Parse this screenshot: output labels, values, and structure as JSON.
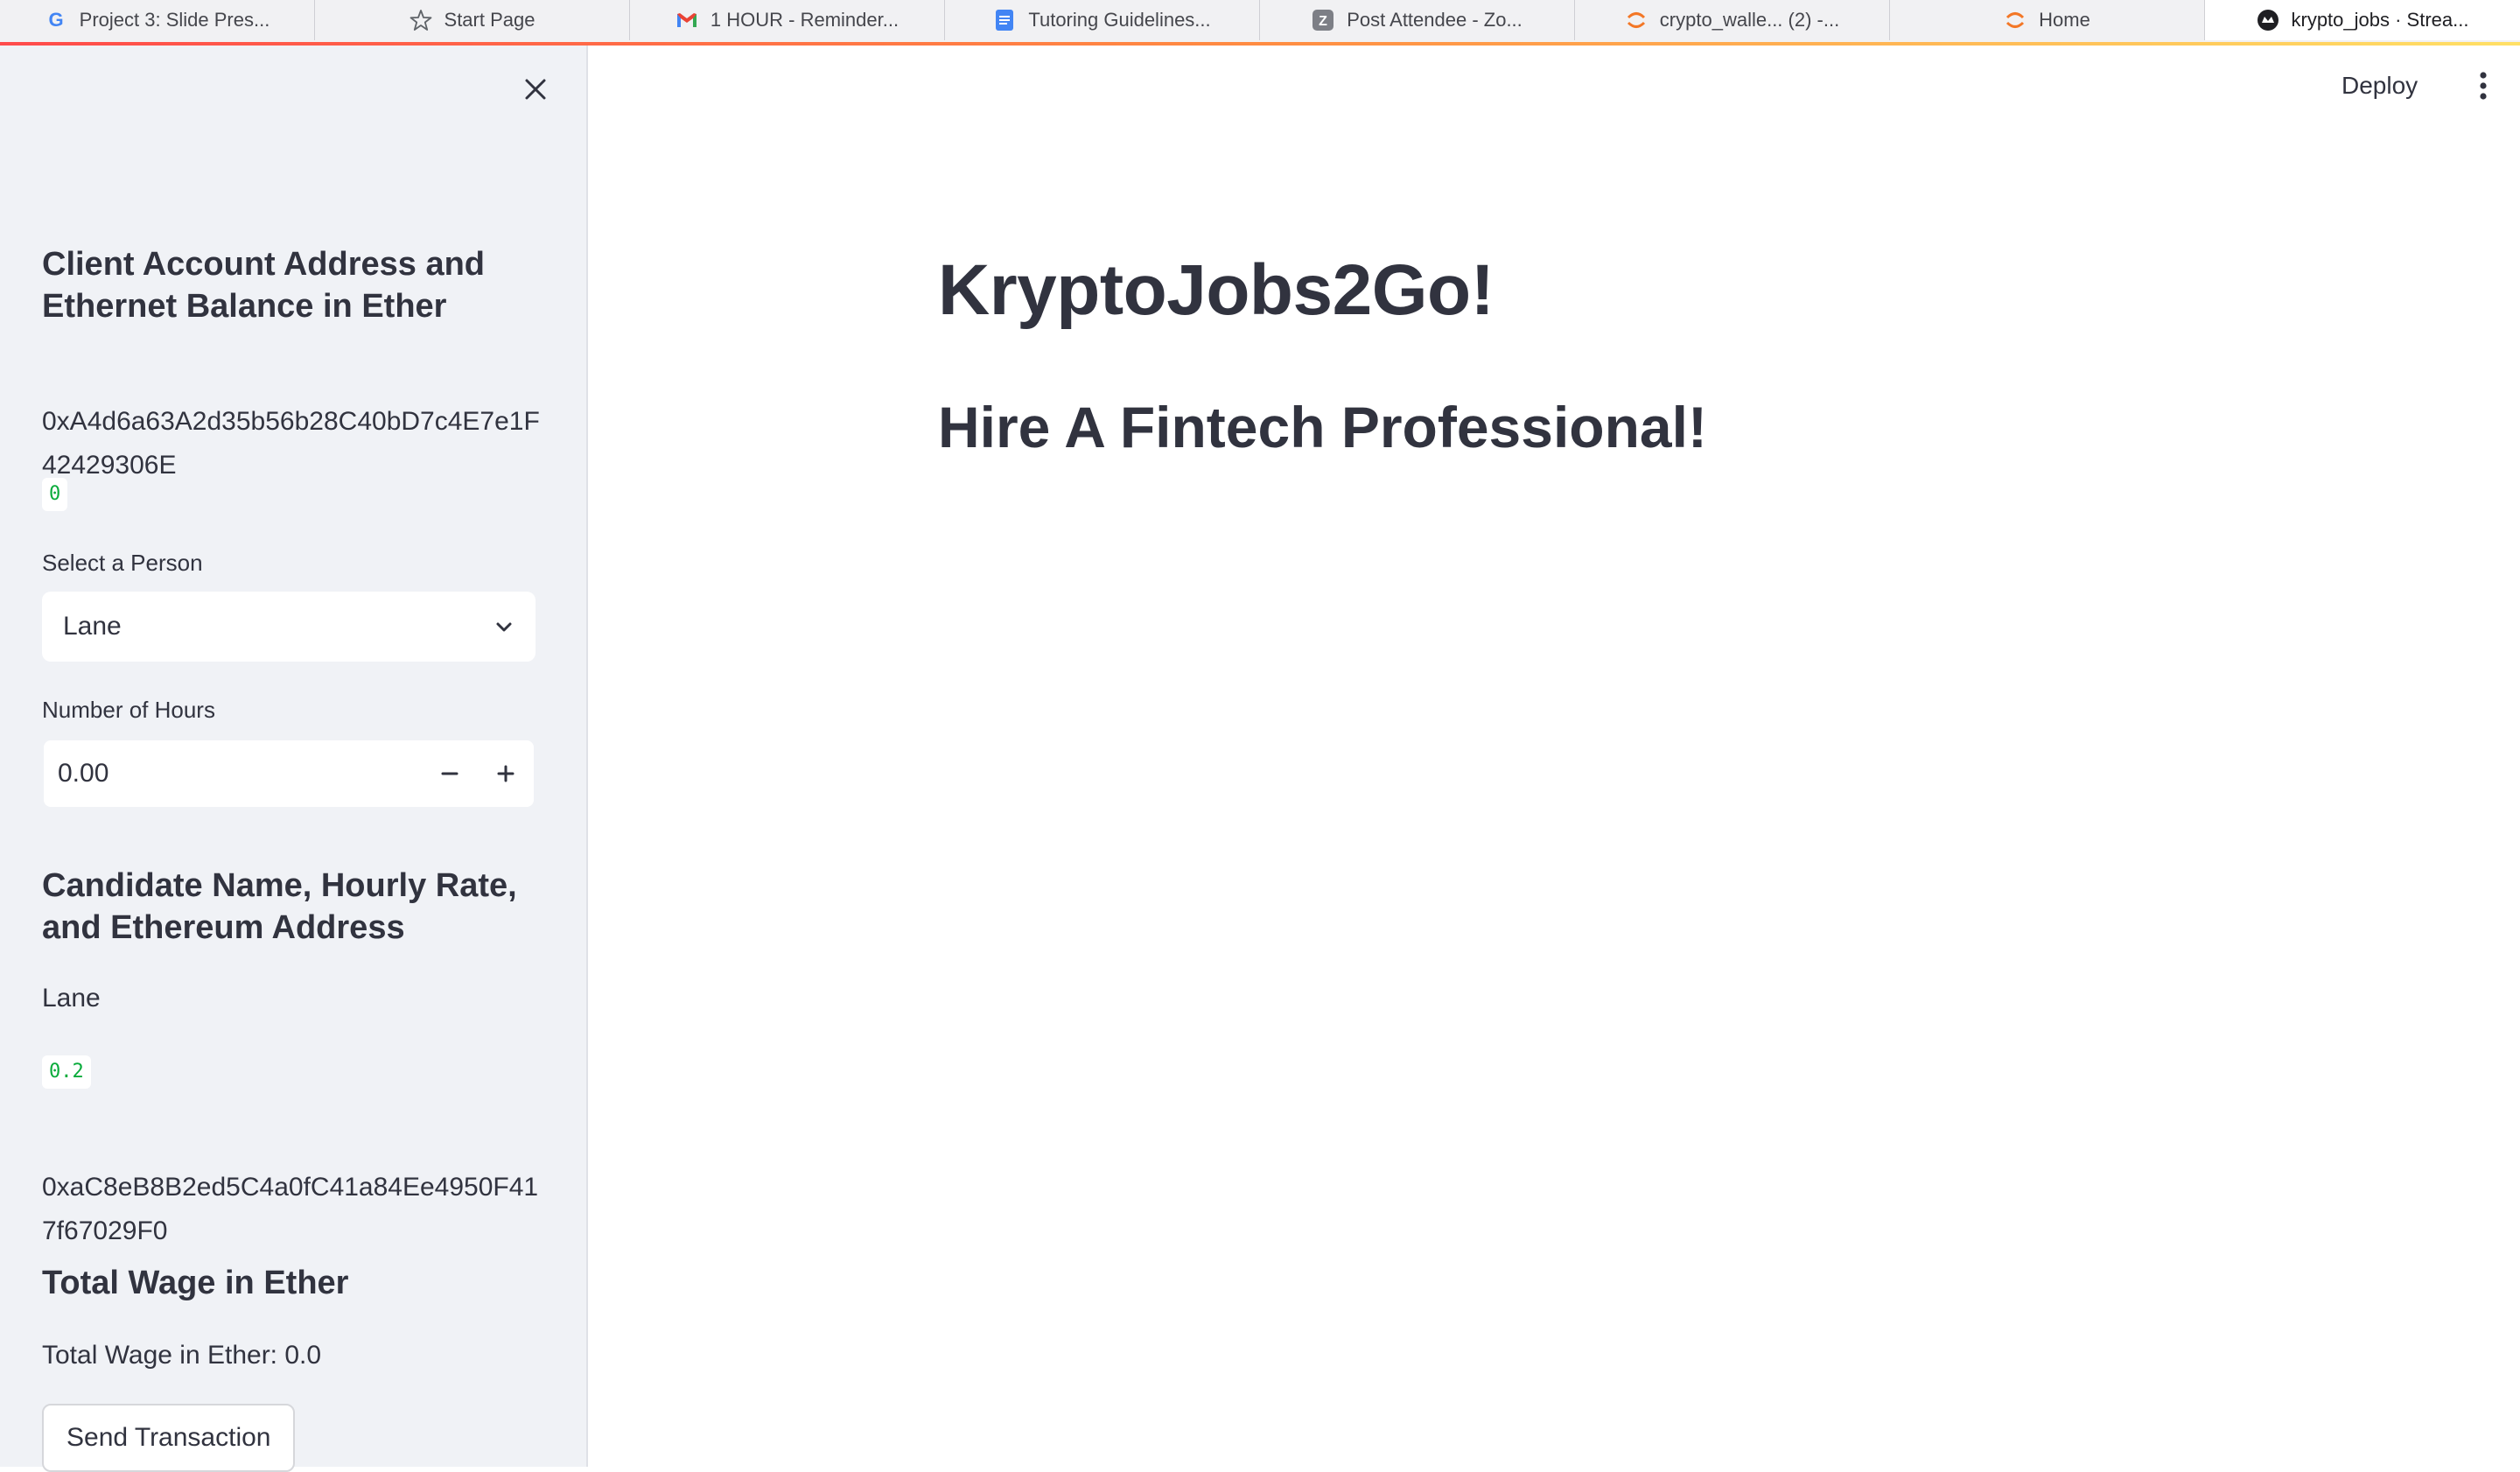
{
  "browser": {
    "tabs": [
      {
        "label": "Project 3: Slide Pres...",
        "icon": "google-icon"
      },
      {
        "label": "Start Page",
        "icon": "star-icon"
      },
      {
        "label": "1 HOUR - Reminder...",
        "icon": "gmail-icon"
      },
      {
        "label": "Tutoring Guidelines...",
        "icon": "docs-icon"
      },
      {
        "label": "Post Attendee - Zo...",
        "icon": "zoom-icon"
      },
      {
        "label": "crypto_walle... (2) -...",
        "icon": "jupyter-icon"
      },
      {
        "label": "Home",
        "icon": "jupyter-icon"
      },
      {
        "label": "krypto_jobs · Strea...",
        "icon": "streamlit-icon"
      }
    ],
    "colors": {
      "loading_bar": [
        "#ff4b4b",
        "#ff8c42",
        "#ffe066"
      ]
    }
  },
  "sidebar": {
    "close_icon": "close-icon",
    "client_heading": "Client Account Address and Ethernet Balance in Ether",
    "client_address": "0xA4d6a63A2d35b56b28C40bD7c4E7e1F42429306E",
    "client_balance": "0",
    "select_label": "Select a Person",
    "select_value": "Lane",
    "hours_label": "Number of Hours",
    "hours_value": "0.00",
    "candidate_heading": "Candidate Name, Hourly Rate, and Ethereum Address",
    "candidate_name": "Lane",
    "candidate_rate": "0.2",
    "candidate_address": "0xaC8eB8B2ed5C4a0fC41a84Ee4950F417f67029F0",
    "wage_heading": "Total Wage in Ether",
    "wage_text": "Total Wage in Ether: 0.0",
    "send_button": "Send Transaction"
  },
  "header": {
    "deploy_label": "Deploy",
    "menu_icon": "kebab-menu-icon"
  },
  "main": {
    "title": "KryptoJobs2Go!",
    "subtitle": "Hire A Fintech Professional!"
  },
  "colors": {
    "code_green": "#09ab3b",
    "sidebar_bg": "#f0f2f6",
    "text": "#31333f"
  }
}
